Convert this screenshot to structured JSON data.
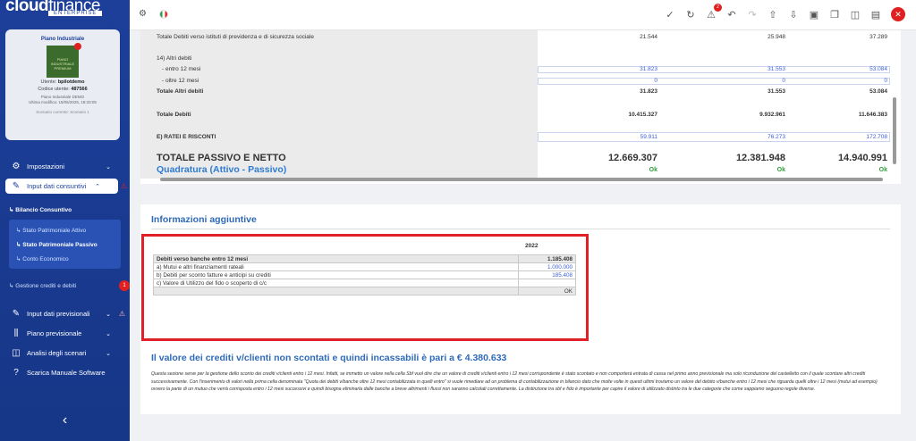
{
  "brand": {
    "name_bold": "cloud",
    "name_light": "finance",
    "tag": "ENTERPRISE"
  },
  "user_card": {
    "plan": "Piano Industriale",
    "badge_text": "PIANO INDUSTRIALE PREMIUM",
    "user_label": "Utente:",
    "user": "bpilotdemo",
    "code_label": "Codice utente:",
    "code": "487566",
    "plan_name": "Piano Industriale DEMO",
    "last_edit": "Ultima modifica: 15/05/2025, 18:33:05",
    "scenario": "Scenario corrente: Scenario 1"
  },
  "menu": {
    "impostazioni": "Impostazioni",
    "input_consuntivi": "Input dati consuntivi",
    "bilancio": "Bilancio Consuntivo",
    "sp_attivo": "Stato Patrimoniale Attivo",
    "sp_passivo": "Stato Patrimoniale Passivo",
    "conto_economico": "Conto Economico",
    "gestione_crediti": "Gestione crediti e debiti",
    "gestione_badge": "1",
    "input_previsionali": "Input dati previsionali",
    "piano_previsionale": "Piano previsionale",
    "analisi_scenari": "Analisi degli scenari",
    "scarica_manuale": "Scarica Manuale Software"
  },
  "toolbar": {
    "alert_count": "2"
  },
  "balance": {
    "rows": {
      "tot_prev": {
        "label": "Totale Debiti verso istituti di previdenza e di sicurezza sociale",
        "v": [
          "21.544",
          "25.948",
          "37.289"
        ]
      },
      "altri": {
        "label": "14) Altri debiti"
      },
      "entro": {
        "label": "- entro 12 mesi",
        "v": [
          "31.823",
          "31.553",
          "53.084"
        ]
      },
      "oltre": {
        "label": "- oltre 12 mesi",
        "v": [
          "0",
          "0",
          "0"
        ]
      },
      "tot_altri": {
        "label": "Totale Altri debiti",
        "v": [
          "31.823",
          "31.553",
          "53.084"
        ]
      },
      "tot_debiti": {
        "label": "Totale Debiti",
        "v": [
          "10.415.327",
          "9.932.961",
          "11.646.383"
        ]
      },
      "ratei": {
        "label": "E) RATEI E RISCONTI",
        "v": [
          "59.911",
          "76.273",
          "172.708"
        ]
      },
      "tot_passivo": {
        "label": "TOTALE PASSIVO E NETTO",
        "v": [
          "12.669.307",
          "12.381.948",
          "14.940.991"
        ]
      },
      "quadratura": {
        "label": "Quadratura (Attivo - Passivo)",
        "v": [
          "Ok",
          "Ok",
          "Ok"
        ]
      }
    }
  },
  "info": {
    "title": "Informazioni aggiuntive",
    "year": "2022",
    "table": [
      {
        "label": "Debiti verso banche entro 12 mesi",
        "value": "1.185.408"
      },
      {
        "label": "a) Mutui e altri finanziamenti rateali",
        "value": "1.000.000"
      },
      {
        "label": "b) Debiti per sconto fatture e anticipi su crediti",
        "value": "185.408"
      },
      {
        "label": "c) Valore di Utilizzo del fido o scoperto di c/c",
        "value": ""
      },
      {
        "label": "",
        "value": "OK"
      }
    ],
    "crediti_title": "Il valore dei crediti v/clienti non scontati e quindi incassabili è pari a € 4.380.633",
    "description": "Questa sezione serve per la gestione dello sconto dei crediti v/clienti entro i 12 mesi. Infatti, se immetto un valore nella cella Sbf vuol dire che un valore di crediti v/clienti entro i 12 mesi corrispondente è stato scontato e non comporterà entrata di cassa nel primo anno previsionale ma solo riconduzione del castelletto con il quale scontare altri crediti successivamente. Con l'inserimento di valori nella prima cella denominata \"Quota dei debiti v/banche oltre 12 mesi contabilizzata in quelli entro\" si vuole rimediare ad un problema di contabilizzazione in bilancio dato che molte volte in questi ultimi troviamo un valore del debito v/banche entro i 12 mesi che riguarda quelli oltre i 12 mesi (mutui ad esempio) ovvero la parte di un mutuo che verrà corrisposta entro i 12 mesi successivi e quindi bisogna eliminarla dalle banche a breve altrimenti i flussi non saranno calcolati correttamente. La distinzione tra sbf e fido è importante per capire il valore di utilizzato distinto tra le due categorie che come sappiamo seguono regole diverse."
  }
}
